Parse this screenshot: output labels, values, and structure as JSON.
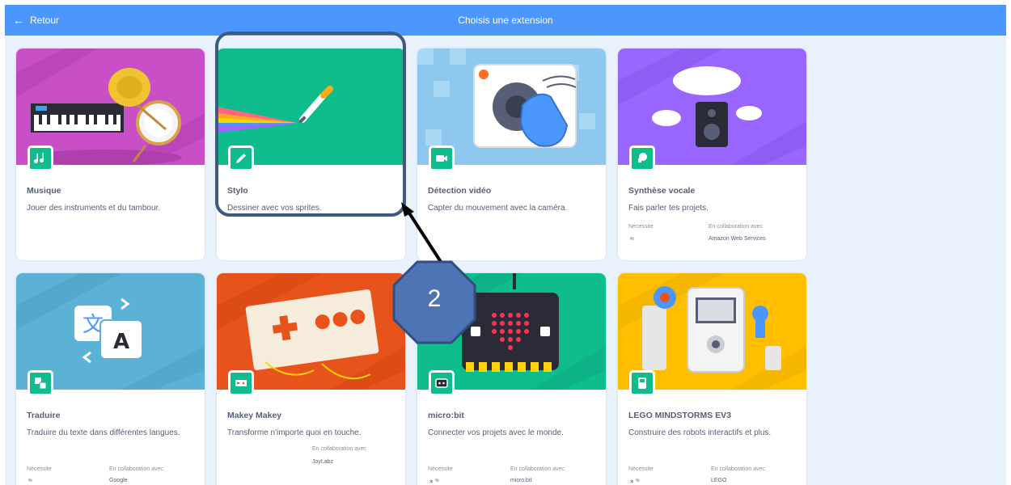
{
  "header": {
    "back_label": "Retour",
    "title": "Choisis une extension"
  },
  "extensions": [
    {
      "name": "Musique",
      "desc": "Jouer des instruments et du tambour."
    },
    {
      "name": "Stylo",
      "desc": "Dessiner avec vos sprites."
    },
    {
      "name": "Détection vidéo",
      "desc": "Capter du mouvement avec la caméra."
    },
    {
      "name": "Synthèse vocale",
      "desc": "Fais parler tes projets.",
      "requires": "Nécessite",
      "collab": "En collaboration avec",
      "collab_with": "Amazon Web Services"
    },
    {
      "name": "Traduire",
      "desc": "Traduire du texte dans différentes langues.",
      "requires": "Nécessite",
      "collab": "En collaboration avec",
      "collab_with": "Google"
    },
    {
      "name": "Makey Makey",
      "desc": "Transforme n'importe quoi en touche.",
      "collab": "En collaboration avec",
      "collab_with": "JoyLabz"
    },
    {
      "name": "micro:bit",
      "desc": "Connecter vos projets avec le monde.",
      "requires": "Nécessite",
      "collab": "En collaboration avec",
      "collab_with": "micro:bit"
    },
    {
      "name": "LEGO MINDSTORMS EV3",
      "desc": "Construire des robots interactifs et plus.",
      "requires": "Nécessite",
      "collab": "En collaboration avec",
      "collab_with": "LEGO"
    }
  ],
  "annotation": {
    "step_number": "2"
  },
  "colors": {
    "header": "#4c97ff",
    "background": "#e9f1fc",
    "badge": "#0fbd8c",
    "highlight_border": "#3e5a7f",
    "marker_fill": "#4e74b6"
  }
}
